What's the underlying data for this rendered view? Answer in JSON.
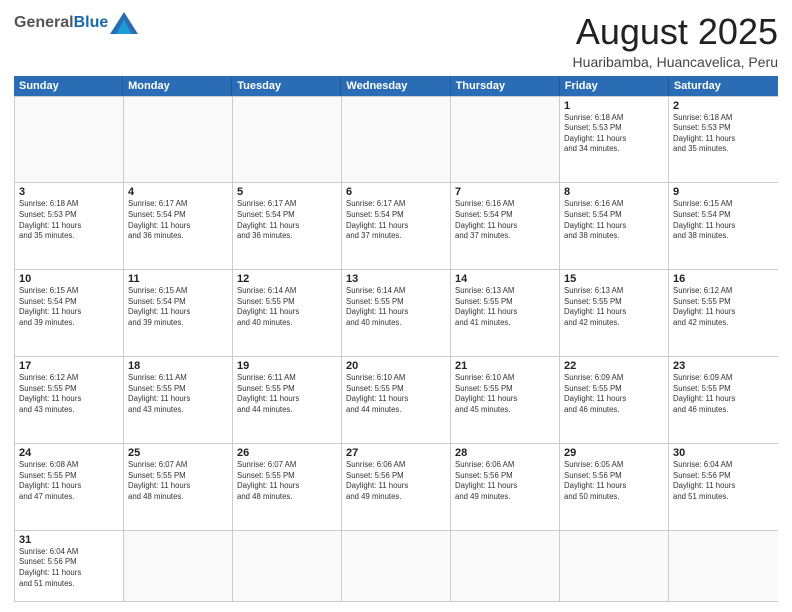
{
  "logo": {
    "general": "General",
    "blue": "Blue"
  },
  "header": {
    "month": "August 2025",
    "location": "Huaribamba, Huancavelica, Peru"
  },
  "weekdays": [
    "Sunday",
    "Monday",
    "Tuesday",
    "Wednesday",
    "Thursday",
    "Friday",
    "Saturday"
  ],
  "rows": [
    [
      {
        "day": "",
        "detail": ""
      },
      {
        "day": "",
        "detail": ""
      },
      {
        "day": "",
        "detail": ""
      },
      {
        "day": "",
        "detail": ""
      },
      {
        "day": "",
        "detail": ""
      },
      {
        "day": "1",
        "detail": "Sunrise: 6:18 AM\nSunset: 5:53 PM\nDaylight: 11 hours\nand 34 minutes."
      },
      {
        "day": "2",
        "detail": "Sunrise: 6:18 AM\nSunset: 5:53 PM\nDaylight: 11 hours\nand 35 minutes."
      }
    ],
    [
      {
        "day": "3",
        "detail": "Sunrise: 6:18 AM\nSunset: 5:53 PM\nDaylight: 11 hours\nand 35 minutes."
      },
      {
        "day": "4",
        "detail": "Sunrise: 6:17 AM\nSunset: 5:54 PM\nDaylight: 11 hours\nand 36 minutes."
      },
      {
        "day": "5",
        "detail": "Sunrise: 6:17 AM\nSunset: 5:54 PM\nDaylight: 11 hours\nand 36 minutes."
      },
      {
        "day": "6",
        "detail": "Sunrise: 6:17 AM\nSunset: 5:54 PM\nDaylight: 11 hours\nand 37 minutes."
      },
      {
        "day": "7",
        "detail": "Sunrise: 6:16 AM\nSunset: 5:54 PM\nDaylight: 11 hours\nand 37 minutes."
      },
      {
        "day": "8",
        "detail": "Sunrise: 6:16 AM\nSunset: 5:54 PM\nDaylight: 11 hours\nand 38 minutes."
      },
      {
        "day": "9",
        "detail": "Sunrise: 6:15 AM\nSunset: 5:54 PM\nDaylight: 11 hours\nand 38 minutes."
      }
    ],
    [
      {
        "day": "10",
        "detail": "Sunrise: 6:15 AM\nSunset: 5:54 PM\nDaylight: 11 hours\nand 39 minutes."
      },
      {
        "day": "11",
        "detail": "Sunrise: 6:15 AM\nSunset: 5:54 PM\nDaylight: 11 hours\nand 39 minutes."
      },
      {
        "day": "12",
        "detail": "Sunrise: 6:14 AM\nSunset: 5:55 PM\nDaylight: 11 hours\nand 40 minutes."
      },
      {
        "day": "13",
        "detail": "Sunrise: 6:14 AM\nSunset: 5:55 PM\nDaylight: 11 hours\nand 40 minutes."
      },
      {
        "day": "14",
        "detail": "Sunrise: 6:13 AM\nSunset: 5:55 PM\nDaylight: 11 hours\nand 41 minutes."
      },
      {
        "day": "15",
        "detail": "Sunrise: 6:13 AM\nSunset: 5:55 PM\nDaylight: 11 hours\nand 42 minutes."
      },
      {
        "day": "16",
        "detail": "Sunrise: 6:12 AM\nSunset: 5:55 PM\nDaylight: 11 hours\nand 42 minutes."
      }
    ],
    [
      {
        "day": "17",
        "detail": "Sunrise: 6:12 AM\nSunset: 5:55 PM\nDaylight: 11 hours\nand 43 minutes."
      },
      {
        "day": "18",
        "detail": "Sunrise: 6:11 AM\nSunset: 5:55 PM\nDaylight: 11 hours\nand 43 minutes."
      },
      {
        "day": "19",
        "detail": "Sunrise: 6:11 AM\nSunset: 5:55 PM\nDaylight: 11 hours\nand 44 minutes."
      },
      {
        "day": "20",
        "detail": "Sunrise: 6:10 AM\nSunset: 5:55 PM\nDaylight: 11 hours\nand 44 minutes."
      },
      {
        "day": "21",
        "detail": "Sunrise: 6:10 AM\nSunset: 5:55 PM\nDaylight: 11 hours\nand 45 minutes."
      },
      {
        "day": "22",
        "detail": "Sunrise: 6:09 AM\nSunset: 5:55 PM\nDaylight: 11 hours\nand 46 minutes."
      },
      {
        "day": "23",
        "detail": "Sunrise: 6:09 AM\nSunset: 5:55 PM\nDaylight: 11 hours\nand 46 minutes."
      }
    ],
    [
      {
        "day": "24",
        "detail": "Sunrise: 6:08 AM\nSunset: 5:55 PM\nDaylight: 11 hours\nand 47 minutes."
      },
      {
        "day": "25",
        "detail": "Sunrise: 6:07 AM\nSunset: 5:55 PM\nDaylight: 11 hours\nand 48 minutes."
      },
      {
        "day": "26",
        "detail": "Sunrise: 6:07 AM\nSunset: 5:55 PM\nDaylight: 11 hours\nand 48 minutes."
      },
      {
        "day": "27",
        "detail": "Sunrise: 6:06 AM\nSunset: 5:56 PM\nDaylight: 11 hours\nand 49 minutes."
      },
      {
        "day": "28",
        "detail": "Sunrise: 6:06 AM\nSunset: 5:56 PM\nDaylight: 11 hours\nand 49 minutes."
      },
      {
        "day": "29",
        "detail": "Sunrise: 6:05 AM\nSunset: 5:56 PM\nDaylight: 11 hours\nand 50 minutes."
      },
      {
        "day": "30",
        "detail": "Sunrise: 6:04 AM\nSunset: 5:56 PM\nDaylight: 11 hours\nand 51 minutes."
      }
    ],
    [
      {
        "day": "31",
        "detail": "Sunrise: 6:04 AM\nSunset: 5:56 PM\nDaylight: 11 hours\nand 51 minutes."
      },
      {
        "day": "",
        "detail": ""
      },
      {
        "day": "",
        "detail": ""
      },
      {
        "day": "",
        "detail": ""
      },
      {
        "day": "",
        "detail": ""
      },
      {
        "day": "",
        "detail": ""
      },
      {
        "day": "",
        "detail": ""
      }
    ]
  ]
}
